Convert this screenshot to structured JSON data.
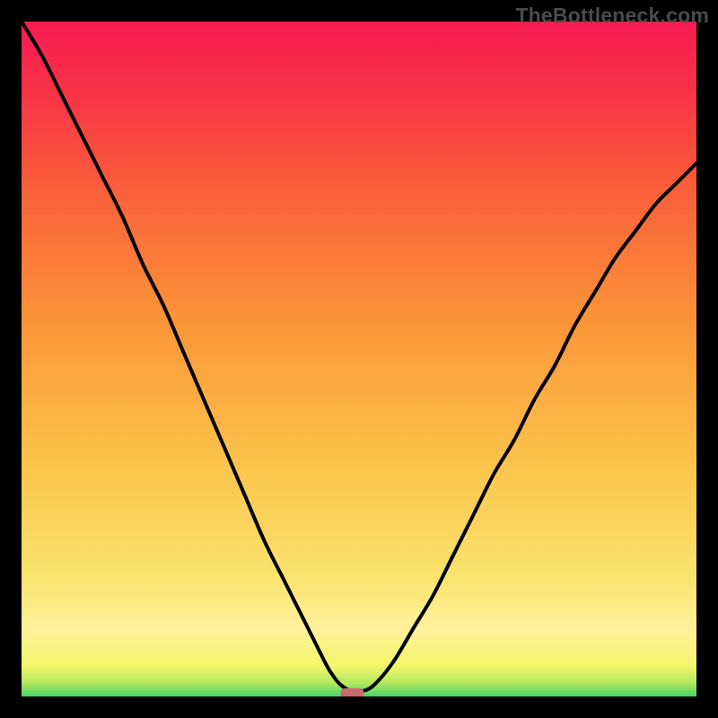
{
  "watermark": "TheBottleneck.com",
  "chart_data": {
    "type": "line",
    "title": "",
    "xlabel": "",
    "ylabel": "",
    "xlim": [
      0,
      100
    ],
    "ylim": [
      0,
      100
    ],
    "x": [
      0,
      3,
      6,
      9,
      12,
      15,
      18,
      21,
      24,
      27,
      30,
      33,
      36,
      39,
      42,
      45,
      46,
      47,
      48,
      49,
      50,
      52,
      55,
      58,
      61,
      64,
      67,
      70,
      73,
      76,
      79,
      82,
      85,
      88,
      91,
      94,
      97,
      100
    ],
    "values": [
      100,
      95,
      89,
      83,
      77,
      71,
      64,
      58,
      51,
      44,
      37,
      30,
      23,
      17,
      11,
      5,
      3.3,
      2.0,
      1.2,
      0.8,
      0.7,
      1.5,
      5,
      10,
      15,
      21,
      27,
      33,
      38,
      44,
      49,
      55,
      60,
      65,
      69,
      73,
      76,
      79
    ],
    "minimum_marker": {
      "x": 49,
      "y": 0.7
    },
    "gradient_stops": [
      {
        "offset": 0.0,
        "color": "#47d36a"
      },
      {
        "offset": 0.02,
        "color": "#b3e85c"
      },
      {
        "offset": 0.045,
        "color": "#f4f66a"
      },
      {
        "offset": 0.1,
        "color": "#fef19b"
      },
      {
        "offset": 0.18,
        "color": "#fae36d"
      },
      {
        "offset": 0.35,
        "color": "#fbc24a"
      },
      {
        "offset": 0.55,
        "color": "#fb9638"
      },
      {
        "offset": 0.75,
        "color": "#fa5f3a"
      },
      {
        "offset": 0.9,
        "color": "#f83147"
      },
      {
        "offset": 1.0,
        "color": "#f71b52"
      }
    ]
  }
}
